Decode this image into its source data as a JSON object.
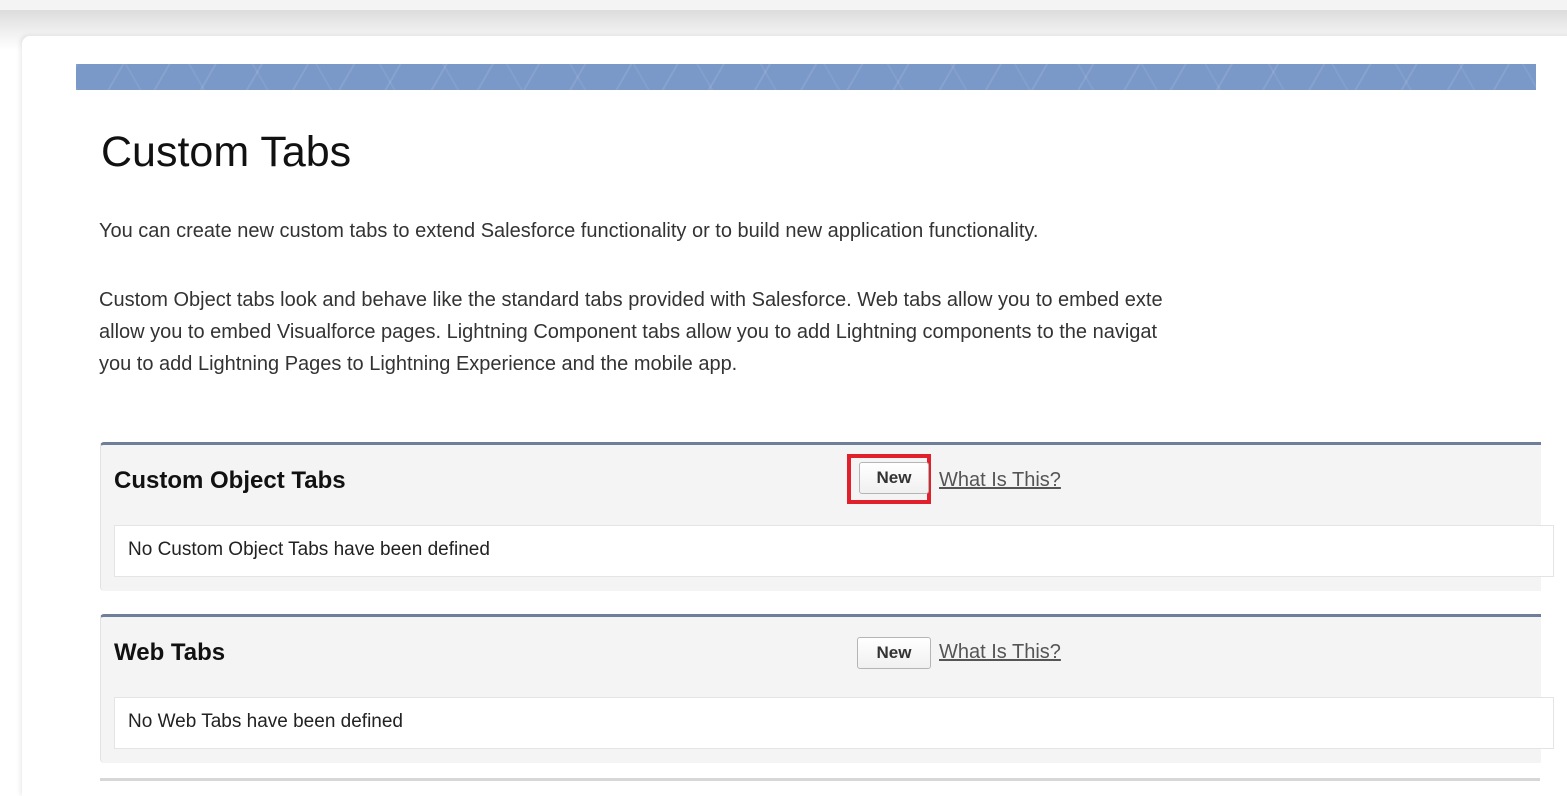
{
  "page": {
    "title": "Custom Tabs",
    "intro": "You can create new custom tabs to extend Salesforce functionality or to build new application functionality.",
    "description_lines": [
      "Custom Object tabs look and behave like the standard tabs provided with Salesforce. Web tabs allow you to embed exte",
      "allow you to embed Visualforce pages. Lightning Component tabs allow you to add Lightning components to the navigat",
      "you to add Lightning Pages to Lightning Experience and the mobile app."
    ]
  },
  "sections": [
    {
      "title": "Custom Object Tabs",
      "new_label": "New",
      "help_label": "What Is This?",
      "empty_message": "No Custom Object Tabs have been defined"
    },
    {
      "title": "Web Tabs",
      "new_label": "New",
      "help_label": "What Is This?",
      "empty_message": "No Web Tabs have been defined"
    }
  ],
  "colors": {
    "banner": "#7a98c8",
    "section_border": "#6f7f99",
    "highlight": "#e0202a"
  }
}
